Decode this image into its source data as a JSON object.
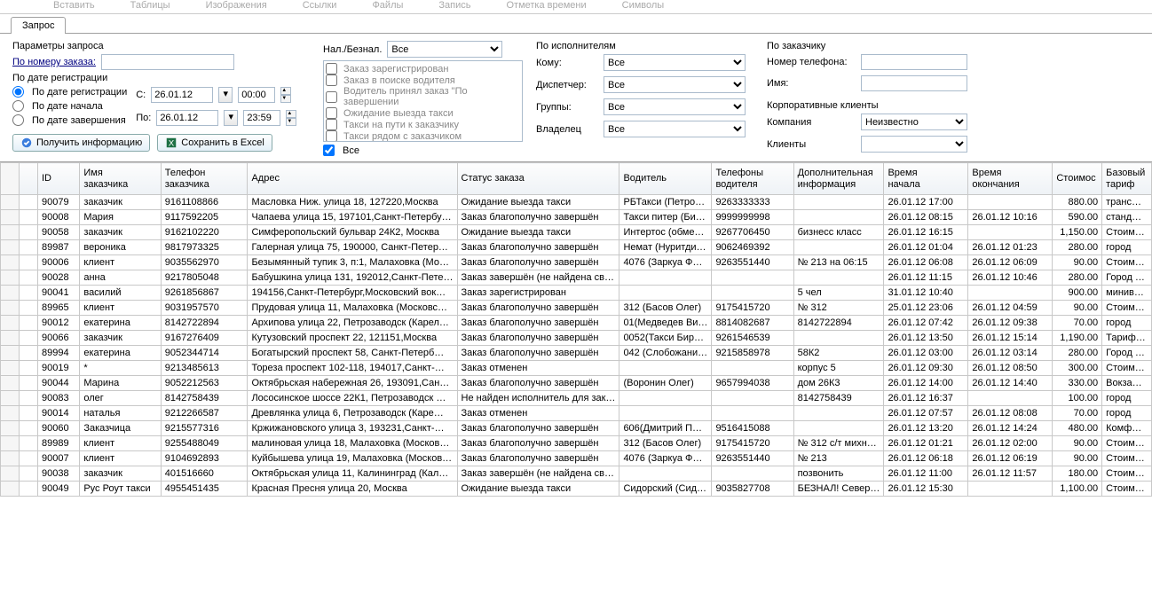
{
  "ribbon_hints": [
    "Вставить",
    "Таблицы",
    "Изображения",
    "Ссылки",
    "Файлы",
    "",
    "Запись",
    "",
    "Отметка времени",
    "Символы"
  ],
  "tab_label": "Запрос",
  "params_title": "Параметры запроса",
  "order_no_label": "По номеру заказа:",
  "by_reg_date_section": "По дате регистрации",
  "radio_reg": "По дате регистрации",
  "radio_start": "По дате начала",
  "radio_end": "По дате завершения",
  "from_label": "С:",
  "to_label": "По:",
  "date_from": "26.01.12",
  "date_to": "26.01.12",
  "time_from": "00:00",
  "time_to": "23:59",
  "btn_fetch": "Получить информацию",
  "btn_excel": "Сохранить в Excel",
  "cash_label": "Нал./Безнал.",
  "cash_value": "Все",
  "status_items": [
    "Заказ зарегистрирован",
    "Заказ в поиске водителя",
    "Водитель принял заказ \"По завершении",
    "Ожидание выезда такси",
    "Такси на пути к заказчику",
    "Такси рядом с заказчиком"
  ],
  "status_all": "Все",
  "exec_title": "По исполнителям",
  "exec_to": "Кому:",
  "exec_disp": "Диспетчер:",
  "exec_groups": "Группы:",
  "exec_owner": "Владелец",
  "exec_all": "Все",
  "cust_title": "По заказчику",
  "cust_phone": "Номер телефона:",
  "cust_name": "Имя:",
  "corp_title": "Корпоративные клиенты",
  "corp_company": "Компания",
  "corp_company_val": "Неизвестно",
  "corp_clients": "Клиенты",
  "columns": [
    "",
    "ID",
    "Имя\nзаказчика",
    "Телефон\nзаказчика",
    "Адрес",
    "Статус заказа",
    "Водитель",
    "Телефоны\nводителя",
    "Дополнительная\nинформация",
    "Время\nначала",
    "Время\nокончания",
    "Стоимос",
    "Базовый\nтариф"
  ],
  "rows": [
    {
      "id": "90079",
      "name": "заказчик",
      "phone": "9161108866",
      "addr": "Масловка Ниж. улица 18, 127220,Москва",
      "status": "Ожидание выезда такси",
      "driver": "РБТакси (Петро…",
      "dphone": "9263333333",
      "info": "",
      "start": "26.01.12 17:00",
      "end": "",
      "cost": "880.00",
      "tariff": "транс…"
    },
    {
      "id": "90008",
      "name": "Мария",
      "phone": "9117592205",
      "addr": "Чапаева улица 15, 197101,Санкт-Петербу…",
      "status": "Заказ благополучно завершён",
      "driver": "Такси питер (Би…",
      "dphone": "9999999998",
      "info": "",
      "start": "26.01.12 08:15",
      "end": "26.01.12 10:16",
      "cost": "590.00",
      "tariff": "станд…"
    },
    {
      "id": "90058",
      "name": "заказчик",
      "phone": "9162102220",
      "addr": "Симферопольский бульвар 24К2, Москва",
      "status": "Ожидание выезда такси",
      "driver": "Интертос (обме…",
      "dphone": "9267706450",
      "info": "бизнесс класс",
      "start": "26.01.12 16:15",
      "end": "",
      "cost": "1,150.00",
      "tariff": "Стоим…"
    },
    {
      "id": "89987",
      "name": "вероника",
      "phone": "9817973325",
      "addr": "Галерная улица 75, 190000, Санкт-Петер…",
      "status": "Заказ благополучно завершён",
      "driver": "Немат (Нуритди…",
      "dphone": "9062469392",
      "info": "",
      "start": "26.01.12 01:04",
      "end": "26.01.12 01:23",
      "cost": "280.00",
      "tariff": "город"
    },
    {
      "id": "90006",
      "name": "клиент",
      "phone": "9035562970",
      "addr": "Безымянный тупик 3, п:1, Малаховка (Мо…",
      "status": "Заказ благополучно завершён",
      "driver": "4076 (Заркуа Ф…",
      "dphone": "9263551440",
      "info": "№ 213 на 06:15",
      "start": "26.01.12 06:08",
      "end": "26.01.12 06:09",
      "cost": "90.00",
      "tariff": "Стоим…"
    },
    {
      "id": "90028",
      "name": "анна",
      "phone": "9217805048",
      "addr": "Бабушкина улица 131, 192012,Санкт-Пете…",
      "status": "Заказ завершён (не найдена св…",
      "driver": "",
      "dphone": "",
      "info": "",
      "start": "26.01.12 11:15",
      "end": "26.01.12 10:46",
      "cost": "280.00",
      "tariff": "Город …"
    },
    {
      "id": "90041",
      "name": "василий",
      "phone": "9261856867",
      "addr": "194156,Санкт-Петербург,Московский вок…",
      "status": "Заказ зарегистрирован",
      "driver": "",
      "dphone": "",
      "info": "5 чел",
      "start": "31.01.12 10:40",
      "end": "",
      "cost": "900.00",
      "tariff": "минив…"
    },
    {
      "id": "89965",
      "name": "клиент",
      "phone": "9031957570",
      "addr": "Прудовая улица 11, Малаховка (Московс…",
      "status": "Заказ благополучно завершён",
      "driver": "312 (Басов Олег)",
      "dphone": "9175415720",
      "info": "№ 312",
      "start": "25.01.12 23:06",
      "end": "26.01.12 04:59",
      "cost": "90.00",
      "tariff": "Стоим…"
    },
    {
      "id": "90012",
      "name": "екатерина",
      "phone": "8142722894",
      "addr": "Архипова улица 22, Петрозаводск (Карел…",
      "status": "Заказ благополучно завершён",
      "driver": "01(Медведев Ви…",
      "dphone": "8814082687",
      "info": "8142722894",
      "start": "26.01.12 07:42",
      "end": "26.01.12 09:38",
      "cost": "70.00",
      "tariff": "город"
    },
    {
      "id": "90066",
      "name": "заказчик",
      "phone": "9167276409",
      "addr": "Кутузовский проспект 22, 121151,Москва",
      "status": "Заказ благополучно завершён",
      "driver": "0052(Такси  Бир…",
      "dphone": "9261546539",
      "info": "",
      "start": "26.01.12 13:50",
      "end": "26.01.12 15:14",
      "cost": "1,190.00",
      "tariff": "Тариф…"
    },
    {
      "id": "89994",
      "name": "екатерина",
      "phone": "9052344714",
      "addr": "Богатырский проспект 58, Санкт-Петерб…",
      "status": "Заказ благополучно завершён",
      "driver": "042 (Слобожани…",
      "dphone": "9215858978",
      "info": "58К2",
      "start": "26.01.12 03:00",
      "end": "26.01.12 03:14",
      "cost": "280.00",
      "tariff": "Город …"
    },
    {
      "id": "90019",
      "name": "*",
      "phone": "9213485613",
      "addr": "Тореза проспект 102-118, 194017,Санкт-…",
      "status": "Заказ отменен",
      "driver": "",
      "dphone": "",
      "info": "корпус 5",
      "start": "26.01.12 09:30",
      "end": "26.01.12 08:50",
      "cost": "300.00",
      "tariff": "Стоим…"
    },
    {
      "id": "90044",
      "name": "Марина",
      "phone": "9052212563",
      "addr": "Октябрьская набережная 26, 193091,Сан…",
      "status": "Заказ благополучно завершён",
      "driver": "(Воронин Олег)",
      "dphone": "9657994038",
      "info": "дом 26К3",
      "start": "26.01.12 14:00",
      "end": "26.01.12 14:40",
      "cost": "330.00",
      "tariff": "Вокза…"
    },
    {
      "id": "90083",
      "name": "олег",
      "phone": "8142758439",
      "addr": "Лососинское шоссе 22К1, Петрозаводск …",
      "status": "Не найден исполнитель для зак…",
      "driver": "",
      "dphone": "",
      "info": "8142758439",
      "start": "26.01.12 16:37",
      "end": "",
      "cost": "100.00",
      "tariff": "город"
    },
    {
      "id": "90014",
      "name": "наталья",
      "phone": "9212266587",
      "addr": "Древлянка улица 6, Петрозаводск (Каре…",
      "status": "Заказ отменен",
      "driver": "",
      "dphone": "",
      "info": "",
      "start": "26.01.12 07:57",
      "end": "26.01.12 08:08",
      "cost": "70.00",
      "tariff": "город"
    },
    {
      "id": "90060",
      "name": "Заказчица",
      "phone": "9215577316",
      "addr": "Кржижановского улица 3, 193231,Санкт-…",
      "status": "Заказ благополучно завершён",
      "driver": "606(Дмитрий П…",
      "dphone": "9516415088",
      "info": "",
      "start": "26.01.12 13:20",
      "end": "26.01.12 14:24",
      "cost": "480.00",
      "tariff": "Комф…"
    },
    {
      "id": "89989",
      "name": "клиент",
      "phone": "9255488049",
      "addr": "малиновая улица 18, Малаховка (Москов…",
      "status": "Заказ благополучно завершён",
      "driver": "312 (Басов Олег)",
      "dphone": "9175415720",
      "info": "№ 312 с/т михн…",
      "start": "26.01.12 01:21",
      "end": "26.01.12 02:00",
      "cost": "90.00",
      "tariff": "Стоим…"
    },
    {
      "id": "90007",
      "name": "клиент",
      "phone": "9104692893",
      "addr": "Куйбышева улица 19, Малаховка (Москов…",
      "status": "Заказ благополучно завершён",
      "driver": "4076 (Заркуа Ф…",
      "dphone": "9263551440",
      "info": "№ 213",
      "start": "26.01.12 06:18",
      "end": "26.01.12 06:19",
      "cost": "90.00",
      "tariff": "Стоим…"
    },
    {
      "id": "90038",
      "name": "заказчик",
      "phone": "401516660",
      "addr": "Октябрьская улица 11, Калининград (Кал…",
      "status": "Заказ завершён (не найдена св…",
      "driver": "",
      "dphone": "",
      "info": "позвонить",
      "start": "26.01.12 11:00",
      "end": "26.01.12 11:57",
      "cost": "180.00",
      "tariff": "Стоим…"
    },
    {
      "id": "90049",
      "name": "Рус Роут такси",
      "phone": "4955451435",
      "addr": "Красная Пресня улица 20, Москва",
      "status": "Ожидание выезда такси",
      "driver": "Сидорский (Сид…",
      "dphone": "9035827708",
      "info": "БЕЗНАЛ! Север…",
      "start": "26.01.12 15:30",
      "end": "",
      "cost": "1,100.00",
      "tariff": "Стоим…"
    }
  ]
}
